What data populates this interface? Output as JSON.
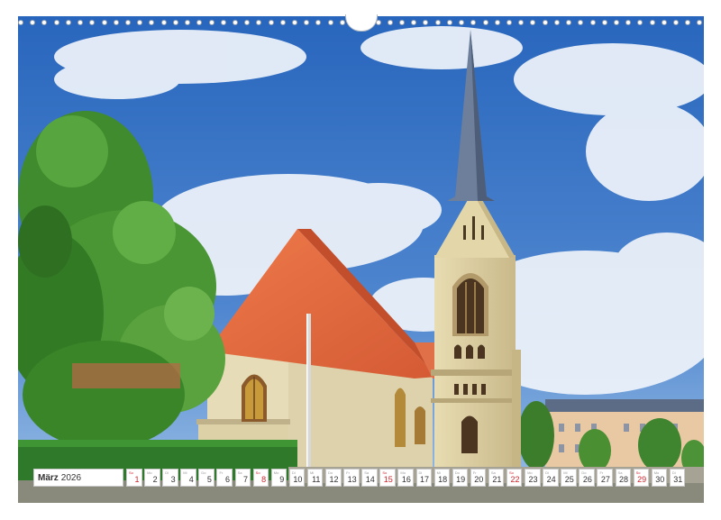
{
  "calendar": {
    "month": "März",
    "year": "2026",
    "days": [
      {
        "n": "1",
        "d": "So",
        "sun": true
      },
      {
        "n": "2",
        "d": "Mo",
        "sun": false
      },
      {
        "n": "3",
        "d": "Di",
        "sun": false
      },
      {
        "n": "4",
        "d": "Mi",
        "sun": false
      },
      {
        "n": "5",
        "d": "Do",
        "sun": false
      },
      {
        "n": "6",
        "d": "Fr",
        "sun": false
      },
      {
        "n": "7",
        "d": "Sa",
        "sun": false
      },
      {
        "n": "8",
        "d": "So",
        "sun": true
      },
      {
        "n": "9",
        "d": "Mo",
        "sun": false
      },
      {
        "n": "10",
        "d": "Di",
        "sun": false
      },
      {
        "n": "11",
        "d": "Mi",
        "sun": false
      },
      {
        "n": "12",
        "d": "Do",
        "sun": false
      },
      {
        "n": "13",
        "d": "Fr",
        "sun": false
      },
      {
        "n": "14",
        "d": "Sa",
        "sun": false
      },
      {
        "n": "15",
        "d": "So",
        "sun": true
      },
      {
        "n": "16",
        "d": "Mo",
        "sun": false
      },
      {
        "n": "17",
        "d": "Di",
        "sun": false
      },
      {
        "n": "18",
        "d": "Mi",
        "sun": false
      },
      {
        "n": "19",
        "d": "Do",
        "sun": false
      },
      {
        "n": "20",
        "d": "Fr",
        "sun": false
      },
      {
        "n": "21",
        "d": "Sa",
        "sun": false
      },
      {
        "n": "22",
        "d": "So",
        "sun": true
      },
      {
        "n": "23",
        "d": "Mo",
        "sun": false
      },
      {
        "n": "24",
        "d": "Di",
        "sun": false
      },
      {
        "n": "25",
        "d": "Mi",
        "sun": false
      },
      {
        "n": "26",
        "d": "Do",
        "sun": false
      },
      {
        "n": "27",
        "d": "Fr",
        "sun": false
      },
      {
        "n": "28",
        "d": "Sa",
        "sun": false
      },
      {
        "n": "29",
        "d": "So",
        "sun": true
      },
      {
        "n": "30",
        "d": "Mo",
        "sun": false
      },
      {
        "n": "31",
        "d": "Di",
        "sun": false
      }
    ]
  },
  "colors": {
    "sky": "#2f6fc4",
    "roof": "#e2683f",
    "stone": "#e6dcb8",
    "tree": "#3d8a2c",
    "sunday": "#d0222a"
  }
}
